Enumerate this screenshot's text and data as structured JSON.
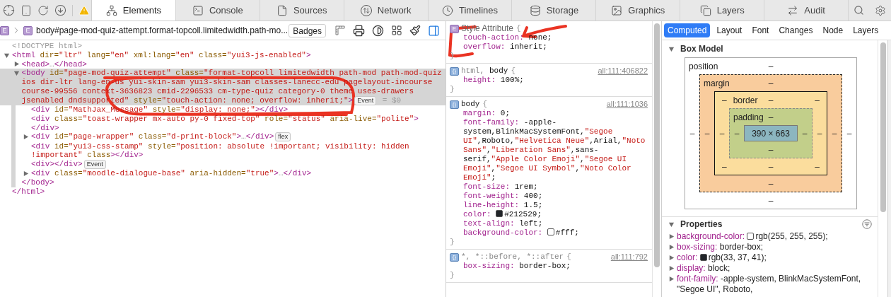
{
  "tabs": [
    {
      "label": "Elements",
      "selected": true
    },
    {
      "label": "Console",
      "selected": false
    },
    {
      "label": "Sources",
      "selected": false
    },
    {
      "label": "Network",
      "selected": false
    },
    {
      "label": "Timelines",
      "selected": false
    },
    {
      "label": "Storage",
      "selected": false
    },
    {
      "label": "Graphics",
      "selected": false
    },
    {
      "label": "Layers",
      "selected": false
    },
    {
      "label": "Audit",
      "selected": false
    }
  ],
  "breadcrumb": [
    {
      "badge": "E"
    },
    {
      "badge": "E",
      "label": "body#page-mod-quiz-attempt.format-topcoll.limitedwidth.path-mo..."
    }
  ],
  "badges_button": "Badges",
  "dom_tree": [
    {
      "selected": false,
      "segments": [
        {
          "kind": "dim",
          "text": "<!DOCTYPE html>"
        }
      ]
    },
    {
      "selected": false,
      "expanded": true,
      "segments": [
        {
          "kind": "tag",
          "text": "<html"
        },
        {
          "kind": "attr",
          "text": " dir="
        },
        {
          "kind": "value",
          "text": "\"ltr\""
        },
        {
          "kind": "attr",
          "text": " lang="
        },
        {
          "kind": "value",
          "text": "\"en\""
        },
        {
          "kind": "attr",
          "text": " xml:lang="
        },
        {
          "kind": "value",
          "text": "\"en\""
        },
        {
          "kind": "attr",
          "text": " class="
        },
        {
          "kind": "value",
          "text": "\"yui3-js-enabled\""
        },
        {
          "kind": "tag",
          "text": ">"
        }
      ],
      "closing": [
        {
          "kind": "tag",
          "text": "</html>"
        }
      ],
      "children": [
        {
          "selected": false,
          "expanded": false,
          "segments": [
            {
              "kind": "tag",
              "text": "<head>"
            },
            {
              "kind": "dim",
              "text": "…"
            },
            {
              "kind": "tag",
              "text": "</head>"
            }
          ]
        },
        {
          "selected": true,
          "expanded": true,
          "segments": [
            {
              "kind": "tag",
              "text": "<body"
            },
            {
              "kind": "attr",
              "text": " id="
            },
            {
              "kind": "value",
              "text": "\"page-mod-quiz-attempt\""
            },
            {
              "kind": "attr",
              "text": " class="
            },
            {
              "kind": "value",
              "text": "\"format-topcoll limitedwidth path-mod path-mod-quiz ios dir-ltr lang-en-us yui-skin-sam yui3-skin-sam classes-lanecc-edu pagelayout-incourse course-99556 context-3636823 cmid-2296533 cm-type-quiz category-0 theme uses-drawers jsenabled dndsupported\""
            },
            {
              "kind": "attr",
              "text": " style="
            },
            {
              "kind": "value",
              "text": "\"touch-action: none; overflow: inherit;\""
            },
            {
              "kind": "tag",
              "text": ">"
            },
            {
              "kind": "badge",
              "text": "Event"
            },
            {
              "kind": "dim",
              "text": " = $0"
            }
          ],
          "closing": [
            {
              "kind": "tag",
              "text": "</body>"
            }
          ],
          "children": [
            {
              "selected": false,
              "segments": [
                {
                  "kind": "tag",
                  "text": "<div"
                },
                {
                  "kind": "attr",
                  "text": " id="
                },
                {
                  "kind": "value",
                  "text": "\"MathJax_Message\""
                },
                {
                  "kind": "attr",
                  "text": " style="
                },
                {
                  "kind": "value",
                  "text": "\"display: none;\""
                },
                {
                  "kind": "tag",
                  "text": "></div>"
                }
              ]
            },
            {
              "selected": false,
              "segments": [
                {
                  "kind": "tag",
                  "text": "<div"
                },
                {
                  "kind": "attr",
                  "text": " class="
                },
                {
                  "kind": "value",
                  "text": "\"toast-wrapper mx-auto py-0 fixed-top\""
                },
                {
                  "kind": "attr",
                  "text": " role="
                },
                {
                  "kind": "value",
                  "text": "\"status\""
                },
                {
                  "kind": "attr",
                  "text": " aria-live="
                },
                {
                  "kind": "value",
                  "text": "\"polite\""
                },
                {
                  "kind": "tag",
                  "text": "> </div>"
                }
              ]
            },
            {
              "selected": false,
              "expanded": false,
              "segments": [
                {
                  "kind": "tag",
                  "text": "<div"
                },
                {
                  "kind": "attr",
                  "text": " id="
                },
                {
                  "kind": "value",
                  "text": "\"page-wrapper\""
                },
                {
                  "kind": "attr",
                  "text": " class="
                },
                {
                  "kind": "value",
                  "text": "\"d-print-block\""
                },
                {
                  "kind": "tag",
                  "text": ">"
                },
                {
                  "kind": "dim",
                  "text": "…"
                },
                {
                  "kind": "tag",
                  "text": "</div>"
                },
                {
                  "kind": "badge",
                  "text": "flex"
                }
              ]
            },
            {
              "selected": false,
              "segments": [
                {
                  "kind": "tag",
                  "text": "<div"
                },
                {
                  "kind": "attr",
                  "text": " id="
                },
                {
                  "kind": "value",
                  "text": "\"yui3-css-stamp\""
                },
                {
                  "kind": "attr",
                  "text": " style="
                },
                {
                  "kind": "value",
                  "text": "\"position: absolute !important; visibility: hidden !important\""
                },
                {
                  "kind": "attr",
                  "text": " class"
                },
                {
                  "kind": "tag",
                  "text": "></div>"
                }
              ]
            },
            {
              "selected": false,
              "segments": [
                {
                  "kind": "tag",
                  "text": "<div></div>"
                },
                {
                  "kind": "badge",
                  "text": "Event"
                }
              ]
            },
            {
              "selected": false,
              "expanded": false,
              "segments": [
                {
                  "kind": "tag",
                  "text": "<div"
                },
                {
                  "kind": "attr",
                  "text": " class="
                },
                {
                  "kind": "value",
                  "text": "\"moodle-dialogue-base\""
                },
                {
                  "kind": "attr",
                  "text": " aria-hidden="
                },
                {
                  "kind": "value",
                  "text": "\"true\""
                },
                {
                  "kind": "tag",
                  "text": ">"
                },
                {
                  "kind": "dim",
                  "text": "…"
                },
                {
                  "kind": "tag",
                  "text": "</div>"
                }
              ]
            }
          ]
        }
      ]
    }
  ],
  "style_rules": [
    {
      "kind": "attribute",
      "badge": "E",
      "selector": [
        {
          "text": "Style Attribute",
          "matched": true
        }
      ],
      "open": "{",
      "close": "}",
      "declarations": [
        {
          "property": "touch-action:",
          "value": "none;"
        },
        {
          "property": "overflow:",
          "value": "inherit;"
        }
      ]
    },
    {
      "kind": "author",
      "badge": "{}",
      "selector": [
        {
          "text": "html,",
          "matched": false
        },
        {
          "text": "body",
          "matched": true
        }
      ],
      "open": "{",
      "close": "}",
      "source": "all:111:406822",
      "declarations": [
        {
          "property": "height:",
          "value": "100%;"
        }
      ]
    },
    {
      "kind": "author",
      "badge": "{}",
      "selector": [
        {
          "text": "body",
          "matched": true
        }
      ],
      "open": "{",
      "close": "}",
      "source": "all:111:1036",
      "declarations": [
        {
          "property": "margin:",
          "value": "0;"
        },
        {
          "property": "font-family:",
          "value": "-apple-system,BlinkMacSystemFont,\"Segoe UI\",Roboto,\"Helvetica Neue\",Arial,\"Noto Sans\",\"Liberation Sans\",sans-serif,\"Apple Color Emoji\",\"Segoe UI Emoji\",\"Segoe UI Symbol\",\"Noto Color Emoji\";"
        },
        {
          "property": "font-size:",
          "value": "1rem;"
        },
        {
          "property": "font-weight:",
          "value": "400;"
        },
        {
          "property": "line-height:",
          "value": "1.5;"
        },
        {
          "property": "color:",
          "value": "#212529;",
          "color": "#212529"
        },
        {
          "property": "text-align:",
          "value": "left;"
        },
        {
          "property": "background-color:",
          "value": "#fff;",
          "color": "#ffffff"
        }
      ]
    },
    {
      "kind": "author",
      "badge": "{}",
      "selector": [
        {
          "text": "*, *::before, *::after",
          "matched": false
        }
      ],
      "open": "{",
      "close": "}",
      "source": "all:111:792",
      "declarations": [
        {
          "property": "box-sizing:",
          "value": "border-box;"
        }
      ]
    }
  ],
  "sidebar_tabs": [
    {
      "label": "Computed",
      "selected": true
    },
    {
      "label": "Layout",
      "selected": false
    },
    {
      "label": "Font",
      "selected": false
    },
    {
      "label": "Changes",
      "selected": false
    },
    {
      "label": "Node",
      "selected": false
    },
    {
      "label": "Layers",
      "selected": false
    }
  ],
  "box_model": {
    "title": "Box Model",
    "expanded": true,
    "position": {
      "label": "position",
      "top": "–",
      "right": "–",
      "bottom": "–",
      "left": "–"
    },
    "margin": {
      "label": "margin",
      "top": "–",
      "right": "–",
      "bottom": "–",
      "left": "–"
    },
    "border": {
      "label": "border",
      "top": "–",
      "right": "–",
      "bottom": "–",
      "left": "–",
      "top_left": "–",
      "top_right": "–",
      "bottom_right": "–",
      "bottom_left": "–"
    },
    "padding": {
      "label": "padding",
      "top": "–",
      "right": "–",
      "bottom": "–",
      "left": "–"
    },
    "content": "390 × 663"
  },
  "properties": {
    "title": "Properties",
    "expanded": true,
    "items": [
      {
        "name": "background-color:",
        "value": "rgb(255, 255, 255);",
        "color": "#ffffff",
        "expanded": false
      },
      {
        "name": "box-sizing:",
        "value": "border-box;",
        "expanded": false
      },
      {
        "name": "color:",
        "value": "rgb(33, 37, 41);",
        "color": "#212529",
        "expanded": false
      },
      {
        "name": "display:",
        "value": "block;",
        "expanded": false
      },
      {
        "name": "font-family:",
        "value": "-apple-system, BlinkMacSystemFont, \"Segoe UI\", Roboto,",
        "expanded": false
      }
    ]
  }
}
